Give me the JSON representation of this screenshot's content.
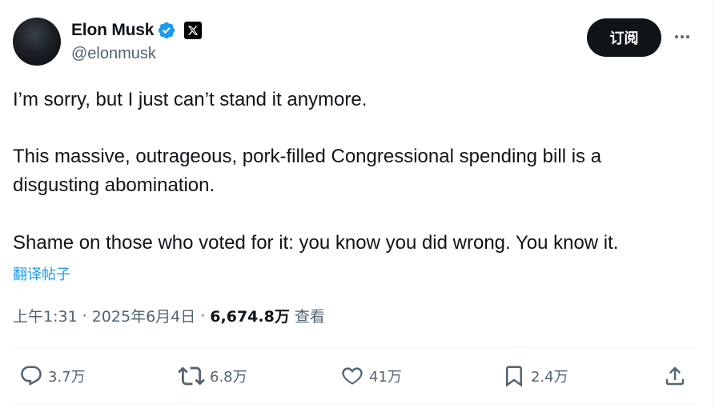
{
  "author": {
    "name": "Elon Musk",
    "handle": "@elonmusk",
    "verified": true,
    "affiliate_badge": "x-logo-icon"
  },
  "header": {
    "subscribe_label": "订阅",
    "more_icon": "more-horizontal-icon"
  },
  "tweet": {
    "lines": [
      "I’m sorry, but I just can’t stand it anymore.",
      "This massive, outrageous, pork-filled Congressional spending bill is a",
      "disgusting abomination.",
      "Shame on those who voted for it: you know you did wrong. You know it."
    ],
    "translate_label": "翻译帖子",
    "time": "上午1:31",
    "separator": "·",
    "date": "2025年6月4日",
    "views_count": "6,674.8万",
    "views_label": "查看"
  },
  "actions": {
    "reply": {
      "icon": "reply-icon",
      "count": "3.7万"
    },
    "repost": {
      "icon": "repost-icon",
      "count": "6.8万"
    },
    "like": {
      "icon": "heart-icon",
      "count": "41万"
    },
    "bookmark": {
      "icon": "bookmark-icon",
      "count": "2.4万"
    },
    "share": {
      "icon": "share-icon"
    }
  },
  "colors": {
    "text_primary": "#0f1419",
    "text_secondary": "#536471",
    "link": "#1d9bf0",
    "verified": "#1d9bf0",
    "button_bg": "#0f1419",
    "divider": "#eff3f4"
  }
}
